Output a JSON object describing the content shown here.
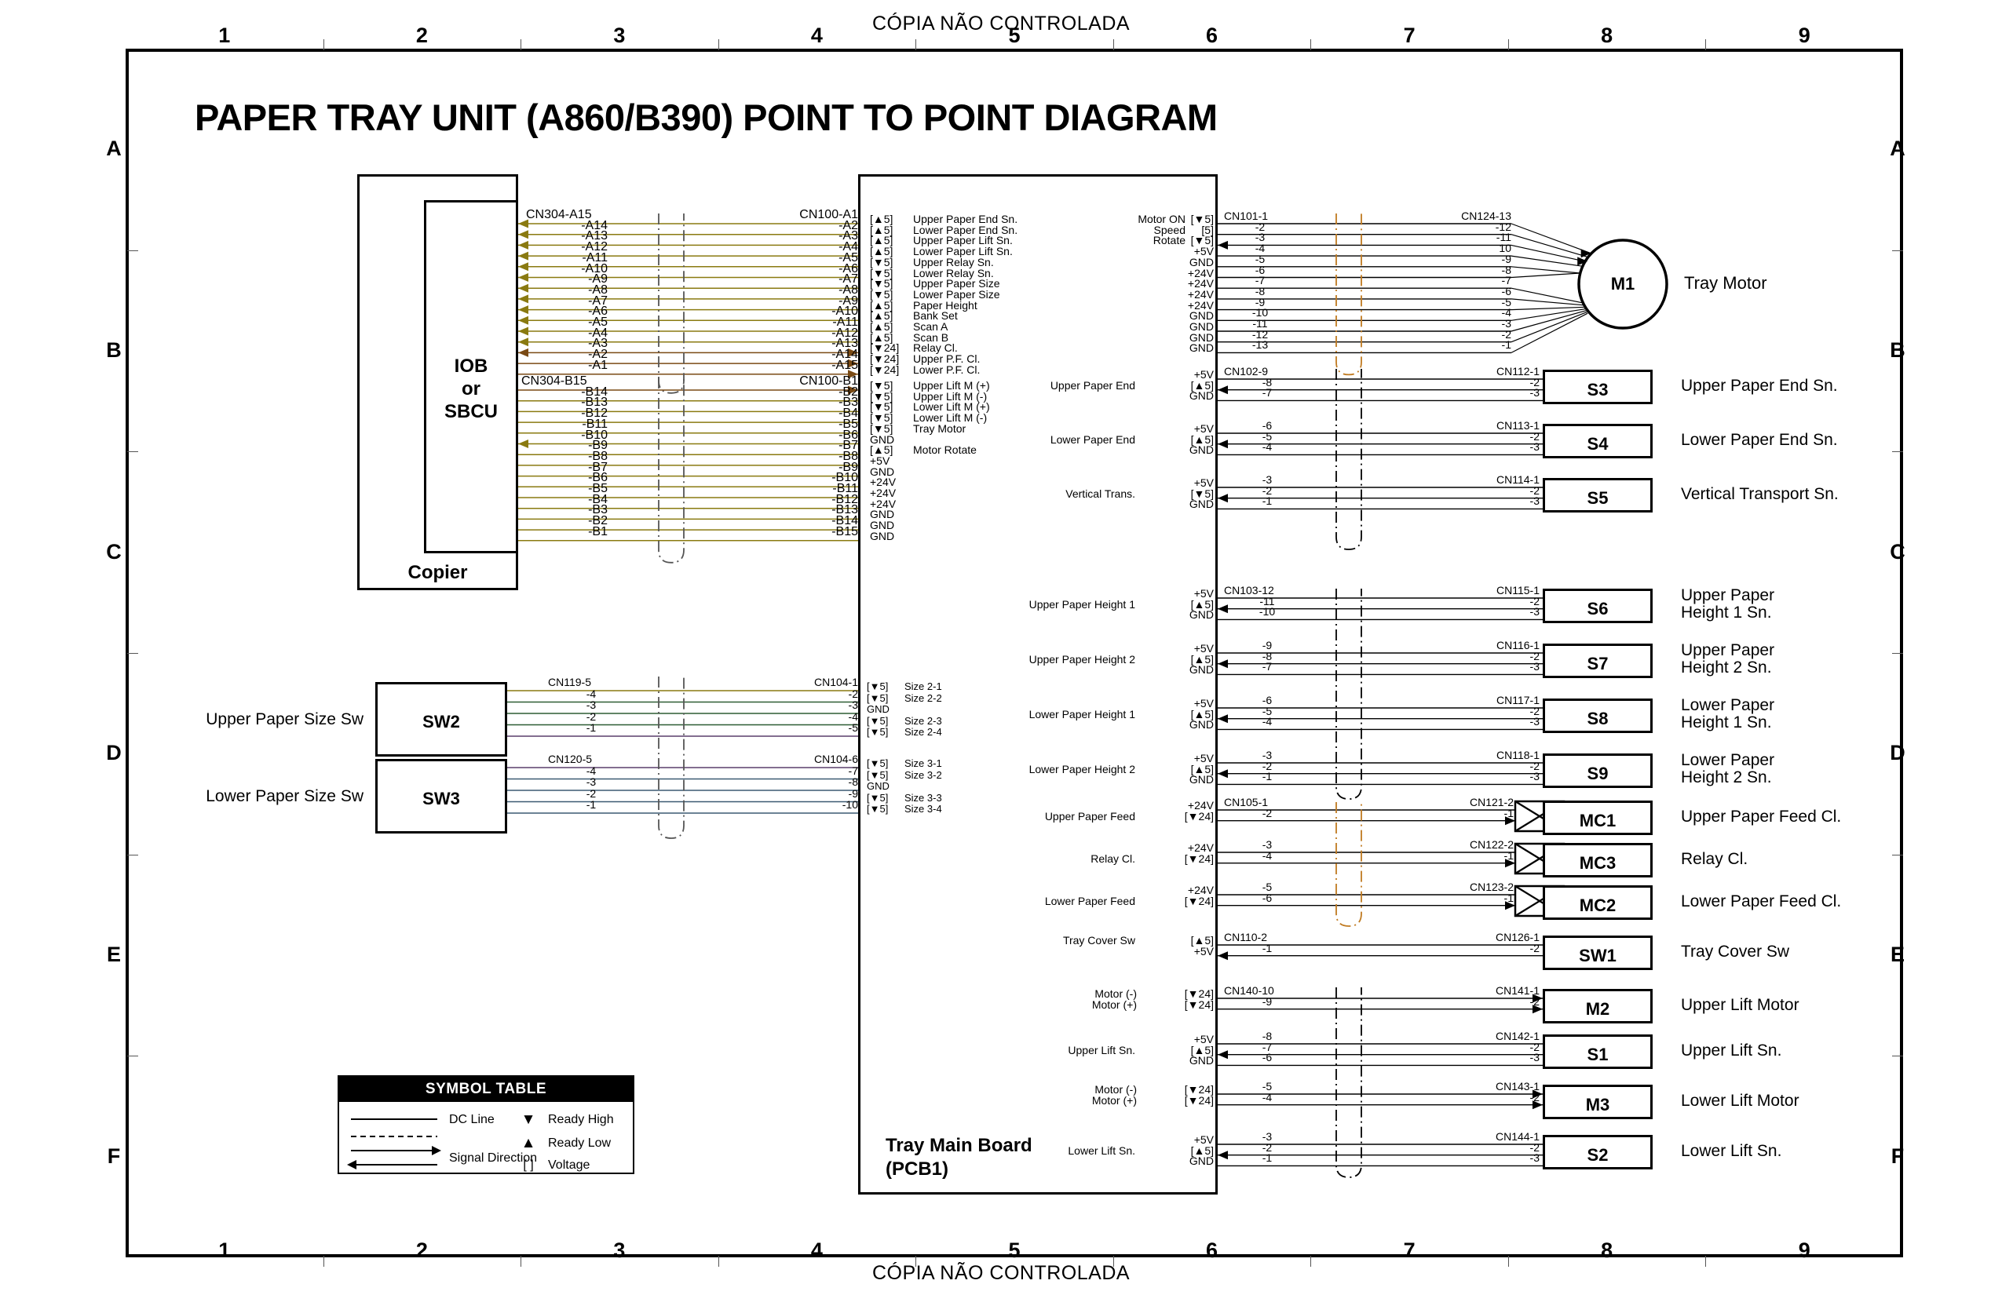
{
  "header": {
    "top": "CÓPIA NÃO CONTROLADA",
    "bottom": "CÓPIA NÃO CONTROLADA"
  },
  "title": "PAPER TRAY UNIT (A860/B390) POINT TO POINT DIAGRAM",
  "grid": {
    "columns": [
      "1",
      "2",
      "3",
      "4",
      "5",
      "6",
      "7",
      "8",
      "9"
    ],
    "rows": [
      "A",
      "B",
      "C",
      "D",
      "E",
      "F"
    ]
  },
  "blocks": {
    "copier": "Copier",
    "iob": "IOB\nor\nSBCU",
    "iob_l1": "IOB",
    "iob_l2": "or",
    "iob_l3": "SBCU",
    "pcb1_l1": "Tray Main Board",
    "pcb1_l2": "(PCB1)"
  },
  "symbol_table": {
    "title": "SYMBOL TABLE",
    "dc_line": "DC Line",
    "signal_direction": "Signal Direction",
    "ready_high": "Ready High",
    "ready_low": "Ready Low",
    "voltage": "Voltage",
    "ready_high_glyph": "▼",
    "ready_low_glyph": "▲",
    "voltage_glyph": "[   ]"
  },
  "harness_a": {
    "left_header": "CN304-A15",
    "right_header": "CN100-A1",
    "left_pins": [
      "-A14",
      "-A13",
      "-A12",
      "-A11",
      "-A10",
      "-A9",
      "-A8",
      "-A7",
      "-A6",
      "-A5",
      "-A4",
      "-A3",
      "-A2",
      "-A1"
    ],
    "right_pins": [
      "-A2",
      "-A3",
      "-A4",
      "-A5",
      "-A6",
      "-A7",
      "-A8",
      "-A9",
      "-A10",
      "-A11",
      "-A12",
      "-A13",
      "-A14",
      "-A15"
    ],
    "volts": [
      "[▲5]",
      "[▲5]",
      "[▲5]",
      "[▲5]",
      "[▼5]",
      "[▼5]",
      "[▼5]",
      "[▼5]",
      "[▲5]",
      "[▲5]",
      "[▲5]",
      "[▲5]",
      "[▼24]",
      "[▼24]",
      "[▼24]"
    ],
    "signals": [
      "Upper Paper End Sn.",
      "Lower Paper End Sn.",
      "Upper Paper Lift Sn.",
      "Lower Paper Lift Sn.",
      "Upper Relay Sn.",
      "Lower Relay Sn.",
      "Upper Paper Size",
      "Lower Paper Size",
      "Paper Height",
      "Bank Set",
      "Scan A",
      "Scan B",
      "Relay Cl.",
      "Upper P.F. Cl.",
      "Lower P.F. Cl."
    ]
  },
  "harness_b": {
    "left_header": "CN304-B15",
    "right_header": "CN100-B1",
    "left_pins": [
      "-B14",
      "-B13",
      "-B12",
      "-B11",
      "-B10",
      "-B9",
      "-B8",
      "-B7",
      "-B6",
      "-B5",
      "-B4",
      "-B3",
      "-B2",
      "-B1"
    ],
    "right_pins": [
      "-B2",
      "-B3",
      "-B4",
      "-B5",
      "-B6",
      "-B7",
      "-B8",
      "-B9",
      "-B10",
      "-B11",
      "-B12",
      "-B13",
      "-B14",
      "-B15"
    ],
    "volts": [
      "[▼5]",
      "[▼5]",
      "[▼5]",
      "[▼5]",
      "[▼5]",
      "GND",
      "[▲5]",
      "+5V",
      "GND",
      "+24V",
      "+24V",
      "+24V",
      "GND",
      "GND",
      "GND"
    ],
    "signals": [
      "Upper Lift M (+)",
      "Upper Lift M (-)",
      "Lower Lift M (+)",
      "Lower Lift M (-)",
      "Tray Motor",
      "",
      "Motor Rotate",
      "",
      "",
      "",
      "",
      "",
      "",
      "",
      ""
    ]
  },
  "tray_motor": {
    "signals": [
      "Motor ON",
      "Speed",
      "Rotate"
    ],
    "volts": [
      "[▼5]",
      "[5]",
      "[▼5]",
      "+5V",
      "GND",
      "+24V",
      "+24V",
      "+24V",
      "+24V",
      "GND",
      "GND",
      "GND",
      "GND"
    ],
    "left_header": "CN101-1",
    "left_pins": [
      "-2",
      "-3",
      "-4",
      "-5",
      "-6",
      "-7",
      "-8",
      "-9",
      "-10",
      "-11",
      "-12",
      "-13"
    ],
    "right_header": "CN124-13",
    "right_pins": [
      "-12",
      "-11",
      "10",
      "-9",
      "-8",
      "-7",
      "-6",
      "-5",
      "-4",
      "-3",
      "-2",
      "-1"
    ],
    "device": "M1",
    "label": "Tray Motor"
  },
  "rows_right": [
    {
      "sig": "Upper Paper End",
      "volt": "[▲5]",
      "top": "+5V",
      "bot": "GND",
      "lheader": "CN102-9",
      "lpins": [
        "-8",
        "-7"
      ],
      "rheader": "CN112-1",
      "rpins": [
        "-2",
        "-3"
      ],
      "device": "S3",
      "label": "Upper Paper End Sn.",
      "type": "sensor"
    },
    {
      "sig": "Lower Paper End",
      "volt": "[▲5]",
      "top": "+5V",
      "bot": "GND",
      "lheader": "",
      "lpins": [
        "-6",
        "-5",
        "-4"
      ],
      "rheader": "CN113-1",
      "rpins": [
        "-2",
        "-3"
      ],
      "device": "S4",
      "label": "Lower Paper End Sn.",
      "type": "sensor"
    },
    {
      "sig": "Vertical Trans.",
      "volt": "[▼5]",
      "top": "+5V",
      "bot": "GND",
      "lheader": "",
      "lpins": [
        "-3",
        "-2",
        "-1"
      ],
      "rheader": "CN114-1",
      "rpins": [
        "-2",
        "-3"
      ],
      "device": "S5",
      "label": "Vertical Transport Sn.",
      "type": "sensor"
    },
    {
      "sig": "Upper Paper Height 1",
      "volt": "[▲5]",
      "top": "+5V",
      "bot": "GND",
      "lheader": "CN103-12",
      "lpins": [
        "-11",
        "-10"
      ],
      "rheader": "CN115-1",
      "rpins": [
        "-2",
        "-3"
      ],
      "device": "S6",
      "label": "Upper Paper\nHeight 1 Sn.",
      "type": "sensor"
    },
    {
      "sig": "Upper Paper Height 2",
      "volt": "[▲5]",
      "top": "+5V",
      "bot": "GND",
      "lheader": "",
      "lpins": [
        "-9",
        "-8",
        "-7"
      ],
      "rheader": "CN116-1",
      "rpins": [
        "-2",
        "-3"
      ],
      "device": "S7",
      "label": "Upper Paper\nHeight 2 Sn.",
      "type": "sensor"
    },
    {
      "sig": "Lower Paper Height 1",
      "volt": "[▲5]",
      "top": "+5V",
      "bot": "GND",
      "lheader": "",
      "lpins": [
        "-6",
        "-5",
        "-4"
      ],
      "rheader": "CN117-1",
      "rpins": [
        "-2",
        "-3"
      ],
      "device": "S8",
      "label": "Lower Paper\nHeight 1 Sn.",
      "type": "sensor"
    },
    {
      "sig": "Lower Paper Height 2",
      "volt": "[▲5]",
      "top": "+5V",
      "bot": "GND",
      "lheader": "",
      "lpins": [
        "-3",
        "-2",
        "-1"
      ],
      "rheader": "CN118-1",
      "rpins": [
        "-2",
        "-3"
      ],
      "device": "S9",
      "label": "Lower Paper\nHeight 2 Sn.",
      "type": "sensor"
    },
    {
      "sig": "Upper Paper Feed",
      "volt": "[▼24]",
      "top": "+24V",
      "bot": "",
      "lheader": "CN105-1",
      "lpins": [
        "-2"
      ],
      "rheader": "CN121-2",
      "rpins": [
        "-1"
      ],
      "device": "MC1",
      "label": "Upper Paper Feed Cl.",
      "type": "clutch"
    },
    {
      "sig": "Relay Cl.",
      "volt": "[▼24]",
      "top": "+24V",
      "bot": "",
      "lheader": "",
      "lpins": [
        "-3",
        "-4"
      ],
      "rheader": "CN122-2",
      "rpins": [
        "-1"
      ],
      "device": "MC3",
      "label": "Relay Cl.",
      "type": "clutch"
    },
    {
      "sig": "Lower Paper Feed",
      "volt": "[▼24]",
      "top": "+24V",
      "bot": "",
      "lheader": "",
      "lpins": [
        "-5",
        "-6"
      ],
      "rheader": "CN123-2",
      "rpins": [
        "-1"
      ],
      "device": "MC2",
      "label": "Lower Paper Feed Cl.",
      "type": "clutch"
    },
    {
      "sig": "Tray Cover Sw",
      "volt": "[▲5]",
      "top": "",
      "bot": "+5V",
      "lheader": "CN110-2",
      "lpins": [
        "-1"
      ],
      "rheader": "CN126-1",
      "rpins": [
        "-2"
      ],
      "device": "SW1",
      "label": "Tray Cover Sw",
      "type": "switch"
    },
    {
      "sig": "Motor (-)",
      "volt": "[▼24]",
      "sig2": "Motor (+)",
      "volt2": "[▼24]",
      "lheader": "CN140-10",
      "lpins": [
        "-9"
      ],
      "rheader": "CN141-1",
      "rpins": [
        "-2"
      ],
      "device": "M2",
      "label": "Upper Lift Motor",
      "type": "motor"
    },
    {
      "sig": "Upper Lift Sn.",
      "volt": "[▲5]",
      "top": "+5V",
      "bot": "GND",
      "lheader": "",
      "lpins": [
        "-8",
        "-7",
        "-6"
      ],
      "rheader": "CN142-1",
      "rpins": [
        "-2",
        "-3"
      ],
      "device": "S1",
      "label": "Upper Lift Sn.",
      "type": "sensor"
    },
    {
      "sig": "Motor (-)",
      "volt": "[▼24]",
      "sig2": "Motor (+)",
      "volt2": "[▼24]",
      "lheader": "",
      "lpins": [
        "-5",
        "-4"
      ],
      "rheader": "CN143-1",
      "rpins": [
        "-2"
      ],
      "device": "M3",
      "label": "Lower Lift Motor",
      "type": "motor"
    },
    {
      "sig": "Lower Lift Sn.",
      "volt": "[▲5]",
      "top": "+5V",
      "bot": "GND",
      "lheader": "",
      "lpins": [
        "-3",
        "-2",
        "-1"
      ],
      "rheader": "CN144-1",
      "rpins": [
        "-2",
        "-3"
      ],
      "device": "S2",
      "label": "Lower Lift Sn.",
      "type": "sensor"
    }
  ],
  "size_switches": [
    {
      "name": "Upper Paper Size Sw",
      "device": "SW2",
      "lheader": "CN119-5",
      "lpins": [
        "-4",
        "-3",
        "-2",
        "-1"
      ],
      "rheader": "CN104-1",
      "rpins": [
        "-2",
        "-3",
        "-4",
        "-5"
      ],
      "volts": [
        "[▼5]",
        "[▼5]",
        "GND",
        "[▼5]",
        "[▼5]"
      ],
      "signals": [
        "Size 2-1",
        "Size 2-2",
        "",
        "Size 2-3",
        "Size 2-4"
      ]
    },
    {
      "name": "Lower Paper Size Sw",
      "device": "SW3",
      "lheader": "CN120-5",
      "lpins": [
        "-4",
        "-3",
        "-2",
        "-1"
      ],
      "rheader": "CN104-6",
      "rpins": [
        "-7",
        "-8",
        "-9",
        "-10"
      ],
      "volts": [
        "[▼5]",
        "[▼5]",
        "GND",
        "[▼5]",
        "[▼5]"
      ],
      "signals": [
        "Size 3-1",
        "Size 3-2",
        "",
        "Size 3-3",
        "Size 3-4"
      ]
    }
  ],
  "colors": {
    "wire_olive": "#8a7a10",
    "wire_brown": "#7a4a14",
    "wire_black": "#000000",
    "wire_green": "#2d5d33",
    "wire_purple": "#5a3f6b",
    "wire_blue": "#3b5a72",
    "dash_orange": "#c07a20"
  }
}
